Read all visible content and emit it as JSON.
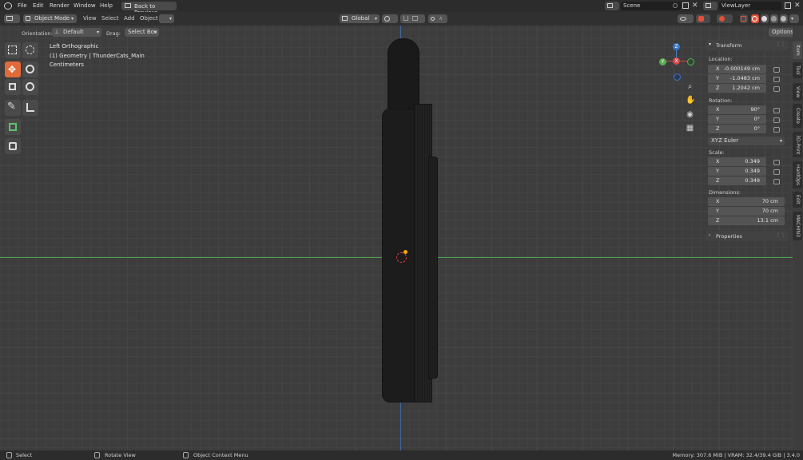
{
  "topbar": {
    "menus": [
      "File",
      "Edit",
      "Render",
      "Window",
      "Help"
    ],
    "back_label": "Back to Previous",
    "scene": "Scene",
    "view_layer": "ViewLayer"
  },
  "header": {
    "mode": "Object Mode",
    "menus": [
      "View",
      "Select",
      "Add",
      "Object"
    ],
    "transform_orientation": "Global",
    "orientation_label": "Orientation:",
    "orientation_value": "Default",
    "drag_label": "Drag:",
    "drag_value": "Select Box",
    "options": "Options"
  },
  "viewport": {
    "view_name": "Left Orthographic",
    "collection": "(1) Geometry | ThunderCats_Main",
    "units": "Centimeters"
  },
  "gizmo": {
    "x": "X",
    "y": "Y",
    "z": "Z"
  },
  "npanel": {
    "transform_title": "Transform",
    "location_label": "Location:",
    "location": [
      {
        "axis": "X",
        "value": "-0.000149 cm"
      },
      {
        "axis": "Y",
        "value": "-1.0483 cm"
      },
      {
        "axis": "Z",
        "value": "1.2042 cm"
      }
    ],
    "rotation_label": "Rotation:",
    "rotation": [
      {
        "axis": "X",
        "value": "90°"
      },
      {
        "axis": "Y",
        "value": "0°"
      },
      {
        "axis": "Z",
        "value": "0°"
      }
    ],
    "rotation_mode": "XYZ Euler",
    "scale_label": "Scale:",
    "scale": [
      {
        "axis": "X",
        "value": "0.349"
      },
      {
        "axis": "Y",
        "value": "0.349"
      },
      {
        "axis": "Z",
        "value": "0.349"
      }
    ],
    "dimensions_label": "Dimensions:",
    "dimensions": [
      {
        "axis": "X",
        "value": "70 cm"
      },
      {
        "axis": "Y",
        "value": "70 cm"
      },
      {
        "axis": "Z",
        "value": "13.1 cm"
      }
    ],
    "properties_title": "Properties"
  },
  "side_tabs": [
    "Item",
    "Tool",
    "View",
    "Create",
    "3D-Print",
    "HardOps",
    "Edit",
    "MACHIN3"
  ],
  "statusbar": {
    "select": "Select",
    "rotate": "Rotate View",
    "context": "Object Context Menu",
    "memory": "Memory: 307.6 MiB | VRAM: 32.4/39.4 GiB | 3.4.0"
  }
}
